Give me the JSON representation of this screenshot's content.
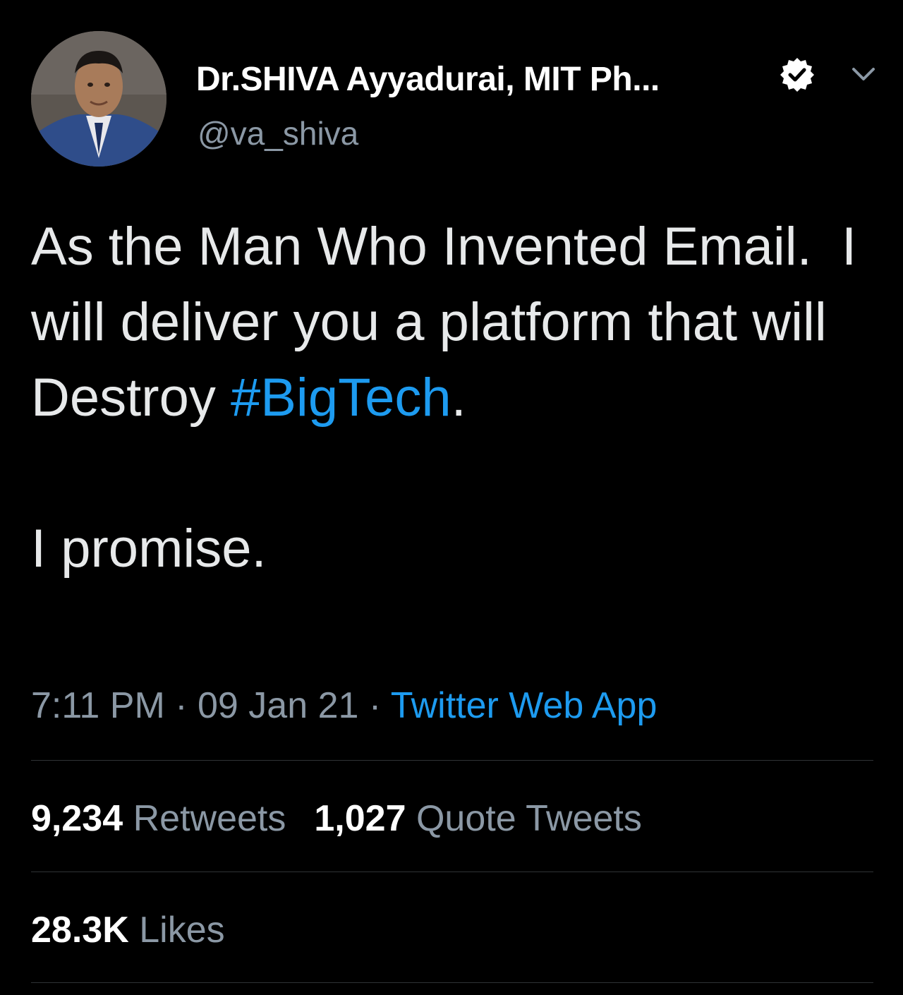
{
  "colors": {
    "background": "#000000",
    "text": "#e7e9ea",
    "muted": "#8b98a5",
    "accent": "#1d9bf0",
    "divider": "#2f3336"
  },
  "author": {
    "display_name": "Dr.SHIVA Ayyadurai, MIT Ph...",
    "handle": "@va_shiva",
    "verified_icon": "verified-badge-icon",
    "menu_icon": "chevron-down-icon"
  },
  "tweet": {
    "text_before_hashtag": "As the Man Who Invented Email.  I will deliver you a platform that will Destroy ",
    "hashtag": "#BigTech",
    "text_after_hashtag": ".",
    "second_paragraph": "I promise."
  },
  "meta": {
    "time": "7:11 PM",
    "separator_1": " · ",
    "date": "09 Jan 21",
    "separator_2": " · ",
    "source": "Twitter Web App"
  },
  "stats": {
    "retweets_count": "9,234",
    "retweets_label": "Retweets",
    "quotes_count": "1,027",
    "quotes_label": "Quote Tweets",
    "likes_count": "28.3K",
    "likes_label": "Likes"
  }
}
